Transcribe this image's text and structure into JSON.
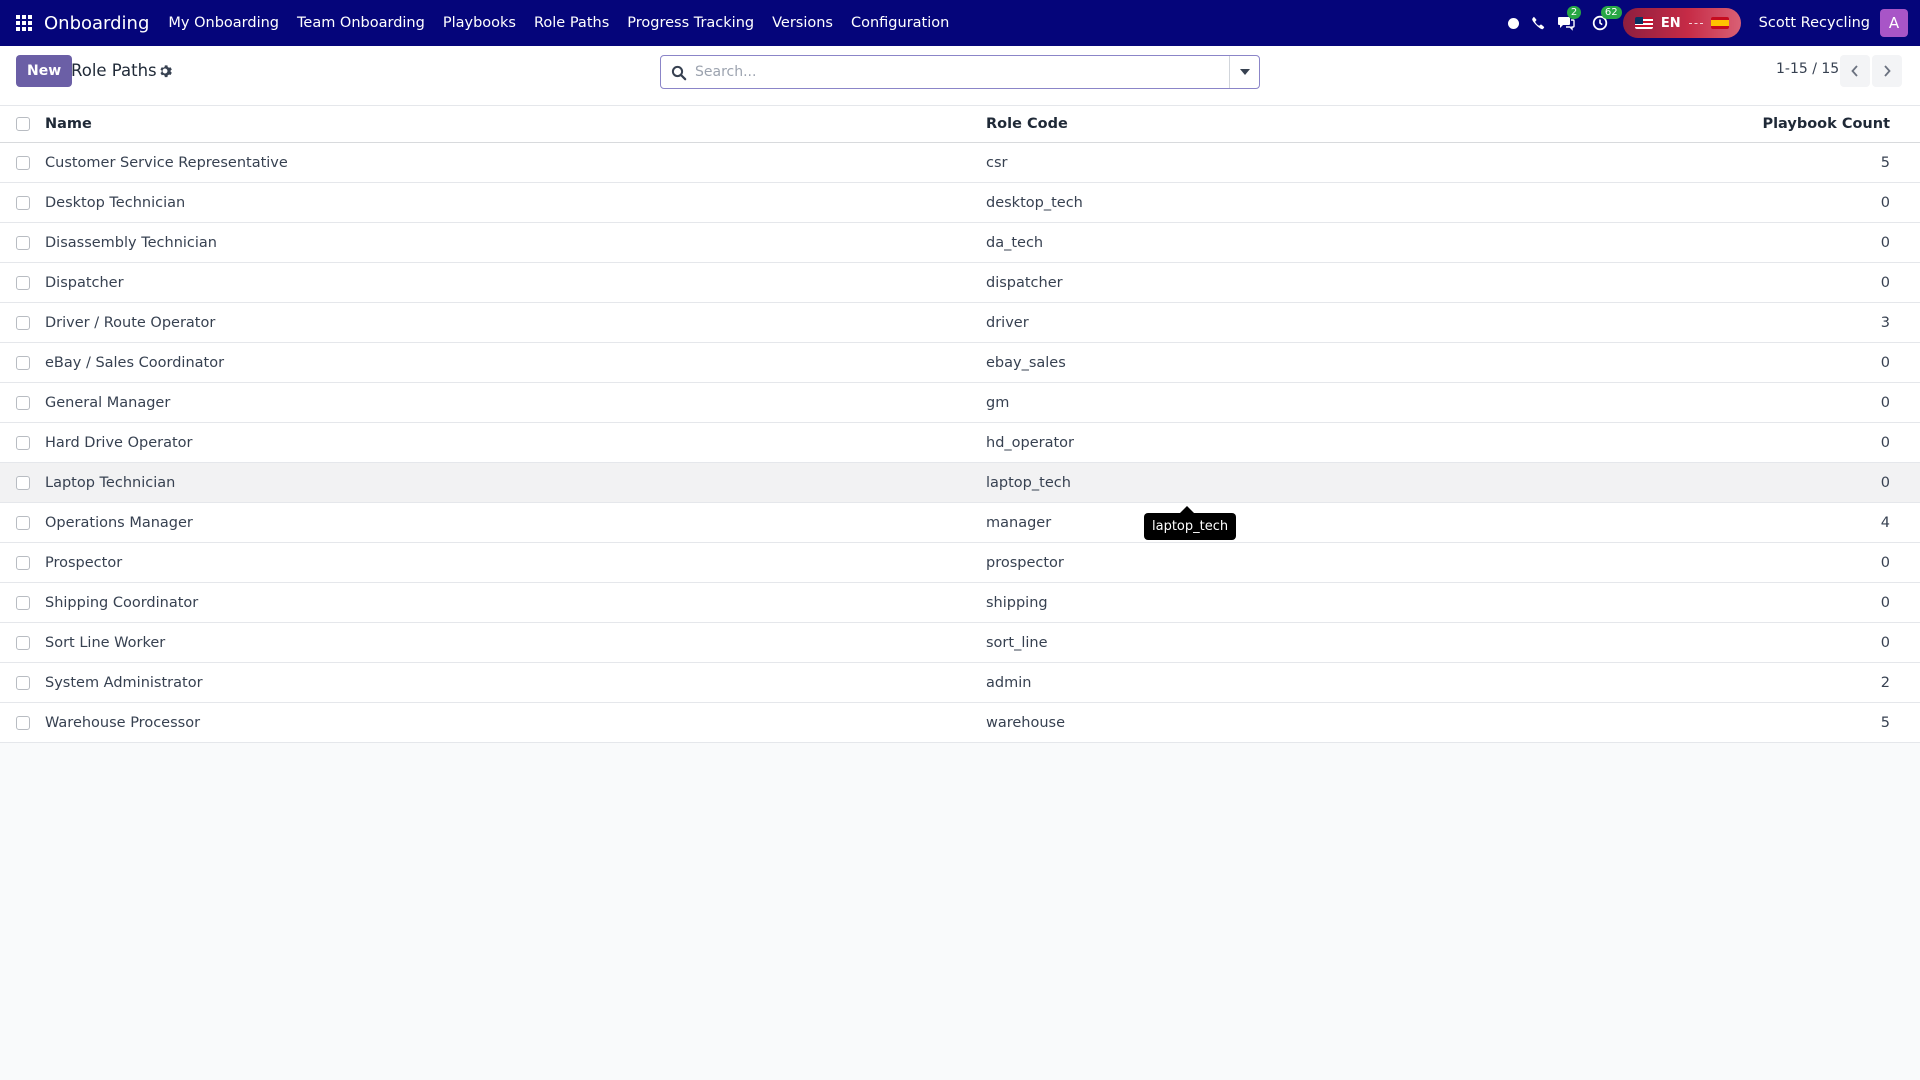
{
  "navbar": {
    "brand": "Onboarding",
    "menu": [
      "My Onboarding",
      "Team Onboarding",
      "Playbooks",
      "Role Paths",
      "Progress Tracking",
      "Versions",
      "Configuration"
    ],
    "messages_badge": "2",
    "activities_badge": "62",
    "lang_label": "EN",
    "company": "Scott Recycling",
    "avatar_letter": "A"
  },
  "control_panel": {
    "new_label": "New",
    "title": "Role Paths",
    "search_placeholder": "Search...",
    "pager": "1-15 / 15"
  },
  "table": {
    "headers": {
      "name": "Name",
      "code": "Role Code",
      "count": "Playbook Count"
    },
    "rows": [
      {
        "name": "Customer Service Representative",
        "code": "csr",
        "count": "5"
      },
      {
        "name": "Desktop Technician",
        "code": "desktop_tech",
        "count": "0"
      },
      {
        "name": "Disassembly Technician",
        "code": "da_tech",
        "count": "0"
      },
      {
        "name": "Dispatcher",
        "code": "dispatcher",
        "count": "0"
      },
      {
        "name": "Driver / Route Operator",
        "code": "driver",
        "count": "3"
      },
      {
        "name": "eBay / Sales Coordinator",
        "code": "ebay_sales",
        "count": "0"
      },
      {
        "name": "General Manager",
        "code": "gm",
        "count": "0"
      },
      {
        "name": "Hard Drive Operator",
        "code": "hd_operator",
        "count": "0"
      },
      {
        "name": "Laptop Technician",
        "code": "laptop_tech",
        "count": "0"
      },
      {
        "name": "Operations Manager",
        "code": "manager",
        "count": "4"
      },
      {
        "name": "Prospector",
        "code": "prospector",
        "count": "0"
      },
      {
        "name": "Shipping Coordinator",
        "code": "shipping",
        "count": "0"
      },
      {
        "name": "Sort Line Worker",
        "code": "sort_line",
        "count": "0"
      },
      {
        "name": "System Administrator",
        "code": "admin",
        "count": "2"
      },
      {
        "name": "Warehouse Processor",
        "code": "warehouse",
        "count": "5"
      }
    ],
    "hovered_row": 8
  },
  "tooltip": {
    "text": "laptop_tech"
  },
  "icons": {
    "apps": "apps-grid-icon",
    "status": "status-dot-icon",
    "phone": "phone-icon",
    "messages": "chat-bubbles-icon",
    "activities": "clock-check-icon",
    "settings": "gear-icon",
    "search": "search-icon",
    "toggle": "caret-down-icon",
    "prev": "chevron-left-icon",
    "next": "chevron-right-icon"
  },
  "colors": {
    "navbar": "#05057a",
    "primary_button": "#6b5fa6",
    "badge": "#28a745",
    "avatar": "#a855c7"
  }
}
